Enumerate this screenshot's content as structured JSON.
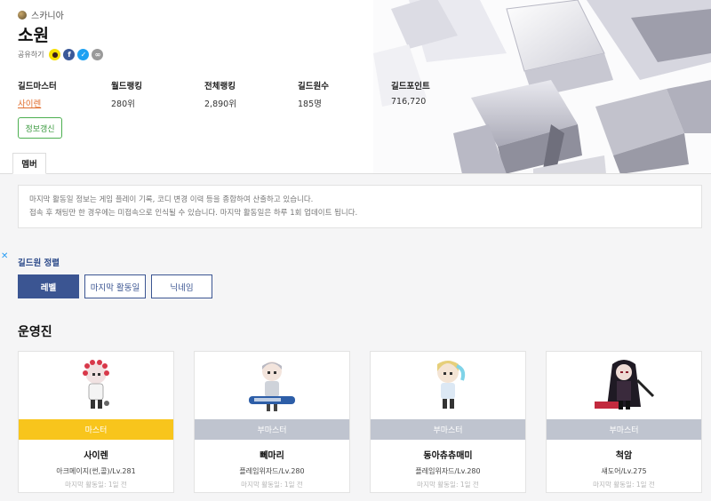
{
  "header": {
    "world": "스카니아",
    "guild_name": "소원",
    "share_label": "공유하기",
    "share_icons": [
      "kakao-icon",
      "facebook-icon",
      "twitter-icon",
      "link-icon"
    ]
  },
  "stats": [
    {
      "key": "길드마스터",
      "value": "사이렌"
    },
    {
      "key": "월드랭킹",
      "value": "280위"
    },
    {
      "key": "전체랭킹",
      "value": "2,890위"
    },
    {
      "key": "길드원수",
      "value": "185명"
    },
    {
      "key": "길드포인트",
      "value": "716,720"
    }
  ],
  "refresh_label": "정보갱신",
  "tab_label": "멤버",
  "notice": {
    "line1": "마지막 활동일 정보는 게임 플레이 기록, 코디 변경 이력 등을 종합하여 산출하고 있습니다.",
    "line2": "접속 후 채팅만 한 경우에는 미접속으로 인식될 수 있습니다. 마지막 활동일은 하루 1회 업데이트 됩니다."
  },
  "ad_close": "✕",
  "sort": {
    "title": "길드원 정렬",
    "buttons": [
      "레벨",
      "마지막 활동일",
      "닉네임"
    ],
    "active": "레벨"
  },
  "section_title": "운영진",
  "members": [
    {
      "role": "마스터",
      "name": "사이렌",
      "job": "아크메이지(썬,콜)/Lv.281",
      "last": "마지막 활동일: 1일 전"
    },
    {
      "role": "부마스터",
      "name": "뻬마리",
      "job": "플레임위자드/Lv.280",
      "last": "마지막 활동일: 1일 전"
    },
    {
      "role": "부마스터",
      "name": "동아츄츄매미",
      "job": "플레임위자드/Lv.280",
      "last": "마지막 활동일: 1일 전"
    },
    {
      "role": "부마스터",
      "name": "척암",
      "job": "섀도어/Lv.275",
      "last": "마지막 활동일: 1일 전"
    }
  ],
  "colors": {
    "accent": "#3b5592",
    "master": "#f8c51c",
    "submaster": "#bfc4cf",
    "refresh": "#4caf50",
    "guild_master_link": "#e06c2c"
  }
}
